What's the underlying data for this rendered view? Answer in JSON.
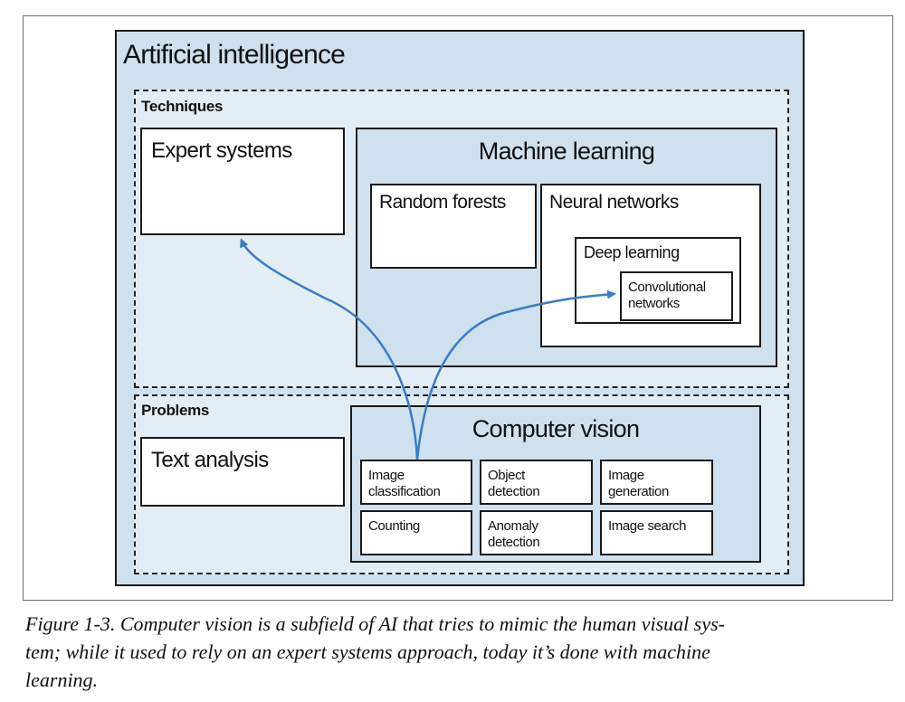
{
  "diagram": {
    "outer_title": "Artificial intelligence",
    "techniques": {
      "label": "Techniques",
      "expert_systems": "Expert systems",
      "machine_learning": {
        "title": "Machine learning",
        "random_forests": "Random forests",
        "neural_networks": "Neural networks",
        "deep_learning": "Deep learning",
        "convolutional_networks": [
          "Convolutional",
          "networks"
        ]
      }
    },
    "problems": {
      "label": "Problems",
      "text_analysis": "Text analysis",
      "computer_vision": {
        "title": "Computer vision",
        "tasks": [
          [
            "Image",
            "classification"
          ],
          [
            "Object",
            "detection"
          ],
          [
            "Image",
            "generation"
          ],
          [
            "Counting"
          ],
          [
            "Anomaly",
            "detection"
          ],
          [
            "Image search"
          ]
        ]
      }
    },
    "arrow_color": "#3a7cc4"
  },
  "caption": [
    "Figure 1-3. Computer vision is a subfield of AI that tries to mimic the human visual sys-",
    "tem; while it used to rely on an expert systems approach, today it’s done with machine",
    "learning."
  ]
}
